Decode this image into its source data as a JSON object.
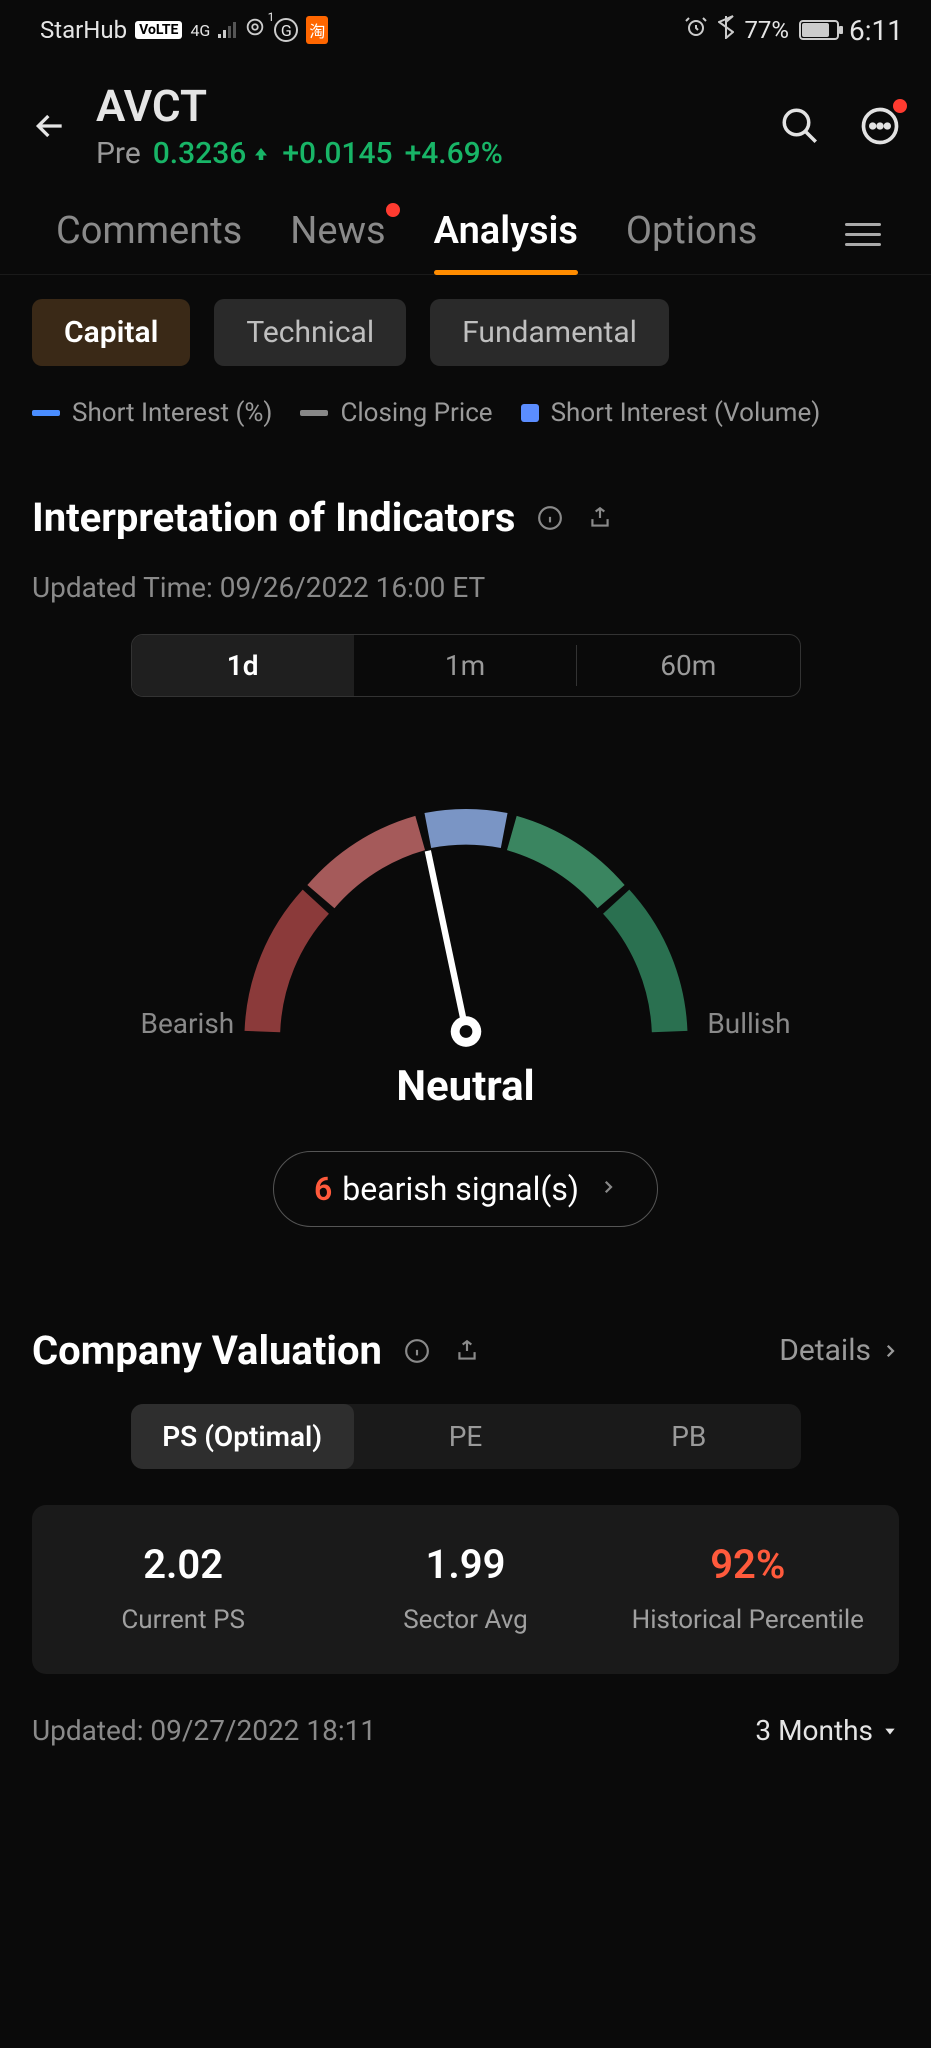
{
  "status": {
    "carrier": "StarHub",
    "volte": "VoLTE",
    "net": "4G",
    "wifi_badge": "1",
    "g_icon": "G",
    "orange": "淘",
    "battery": "77%",
    "time": "6:11"
  },
  "header": {
    "ticker": "AVCT",
    "pre_label": "Pre",
    "price": "0.3236",
    "change": "+0.0145",
    "pct": "+4.69%"
  },
  "tabs": {
    "comments": "Comments",
    "news": "News",
    "analysis": "Analysis",
    "options": "Options"
  },
  "pills": {
    "capital": "Capital",
    "technical": "Technical",
    "fundamental": "Fundamental"
  },
  "legend": {
    "short_pct": "Short Interest (%)",
    "closing": "Closing Price",
    "short_vol": "Short Interest (Volume)"
  },
  "indicators": {
    "title": "Interpretation of Indicators",
    "updated": "Updated Time: 09/26/2022 16:00 ET",
    "timeframes": {
      "d1": "1d",
      "m1": "1m",
      "m60": "60m"
    },
    "bearish": "Bearish",
    "bullish": "Bullish",
    "result": "Neutral",
    "signal_count": "6",
    "signal_text": "bearish signal(s)"
  },
  "valuation": {
    "title": "Company Valuation",
    "details": "Details",
    "seg": {
      "ps": "PS (Optimal)",
      "pe": "PE",
      "pb": "PB"
    },
    "cols": {
      "current": {
        "value": "2.02",
        "label": "Current PS"
      },
      "sector": {
        "value": "1.99",
        "label": "Sector Avg"
      },
      "pct": {
        "value": "92%",
        "label": "Historical Percentile"
      }
    },
    "updated": "Updated: 09/27/2022  18:11",
    "period": "3 Months"
  },
  "colors": {
    "blue": "#4a7dff",
    "grey": "#888",
    "lightblue": "#6a9eff"
  }
}
